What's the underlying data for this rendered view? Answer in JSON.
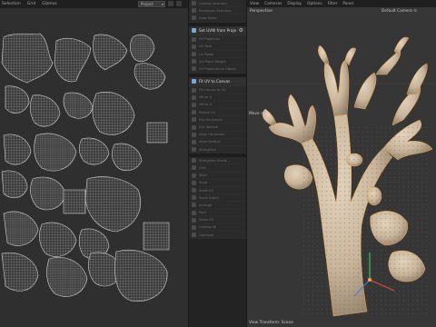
{
  "uv_editor": {
    "menu": [
      "Selection",
      "Grid",
      "Gizmos"
    ],
    "projection_select": "Project",
    "islands_count": 26
  },
  "tool_panel": {
    "tools": [
      {
        "label": "Unwrap Selected",
        "style": "dim"
      },
      {
        "label": "Rectangle Selection",
        "style": "dim"
      },
      {
        "label": "Auto Seam",
        "style": "dim"
      },
      {
        "label": "Set UVW from Projection",
        "style": "header"
      },
      {
        "label": "Fit Projection",
        "style": "dim"
      },
      {
        "label": "UV Pack",
        "style": "dim"
      },
      {
        "label": "UV Relax",
        "style": "dim"
      },
      {
        "label": "Set Point Weight",
        "style": "dim"
      },
      {
        "label": "Fit Projection to Object",
        "style": "dim"
      },
      {
        "label": "Fit UV to Canvas",
        "style": "header"
      },
      {
        "label": "Fit Canvas to UV",
        "style": "dim"
      },
      {
        "label": "Mirror U",
        "style": "dim"
      },
      {
        "label": "Mirror V",
        "style": "dim"
      },
      {
        "label": "Rotate UV",
        "style": "dim"
      },
      {
        "label": "Flip Horizontal",
        "style": "dim"
      },
      {
        "label": "Flip Vertical",
        "style": "dim"
      },
      {
        "label": "Align Horizontal",
        "style": "dim"
      },
      {
        "label": "Align Vertical",
        "style": "dim"
      },
      {
        "label": "Straighten",
        "style": "dim"
      },
      {
        "label": "Straighten Shells",
        "style": "dim"
      },
      {
        "label": "Grid",
        "style": "dim"
      },
      {
        "label": "Weld",
        "style": "dim"
      },
      {
        "label": "Snap",
        "style": "dim"
      },
      {
        "label": "Scale UV",
        "style": "dim"
      },
      {
        "label": "Scale Island",
        "style": "dim"
      },
      {
        "label": "Arrange",
        "style": "dim"
      },
      {
        "label": "Pack",
        "style": "dim"
      },
      {
        "label": "Relax UV",
        "style": "dim"
      },
      {
        "label": "Unwrap All",
        "style": "dim"
      },
      {
        "label": "Optimize",
        "style": "dim"
      }
    ]
  },
  "viewport": {
    "menu": [
      "View",
      "Cameras",
      "Display",
      "Options",
      "Filter",
      "Panel"
    ],
    "view_name": "Perspective",
    "camera": "Default Camera ⊙",
    "side_label": "Move ⊙",
    "status": "View Transform: Scene"
  },
  "colors": {
    "mesh_fill": "#c9b7a0",
    "mesh_shadow": "#8a7a66",
    "selection_edge": "#f2a44a",
    "uv_island": "#bdbdbd"
  }
}
